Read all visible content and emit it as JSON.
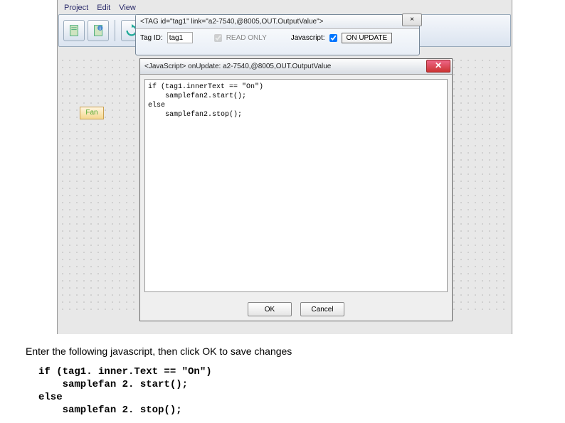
{
  "menu": {
    "project": "Project",
    "edit": "Edit",
    "view": "View"
  },
  "tag_dialog": {
    "title": "<TAG id=\"tag1\" link=\"a2-7540,@8005,OUT.OutputValue\">",
    "close": "×",
    "tagid_label": "Tag ID:",
    "tagid_value": "tag1",
    "readonly_label": "READ ONLY",
    "javascript_label": "Javascript:",
    "onupdate_btn": "ON UPDATE"
  },
  "js_dialog": {
    "title": "<JavaScript> onUpdate: a2-7540,@8005,OUT.OutputValue",
    "code": "if (tag1.innerText == \"On\")\n    samplefan2.start();\nelse\n    samplefan2.stop();",
    "ok": "OK",
    "cancel": "Cancel"
  },
  "fan_tab": "Fan",
  "instructions": "Enter the following javascript, then click OK to save changes",
  "code": "if (tag1. inner.Text == \"On\")\n    samplefan 2. start();\nelse\n    samplefan 2. stop();"
}
